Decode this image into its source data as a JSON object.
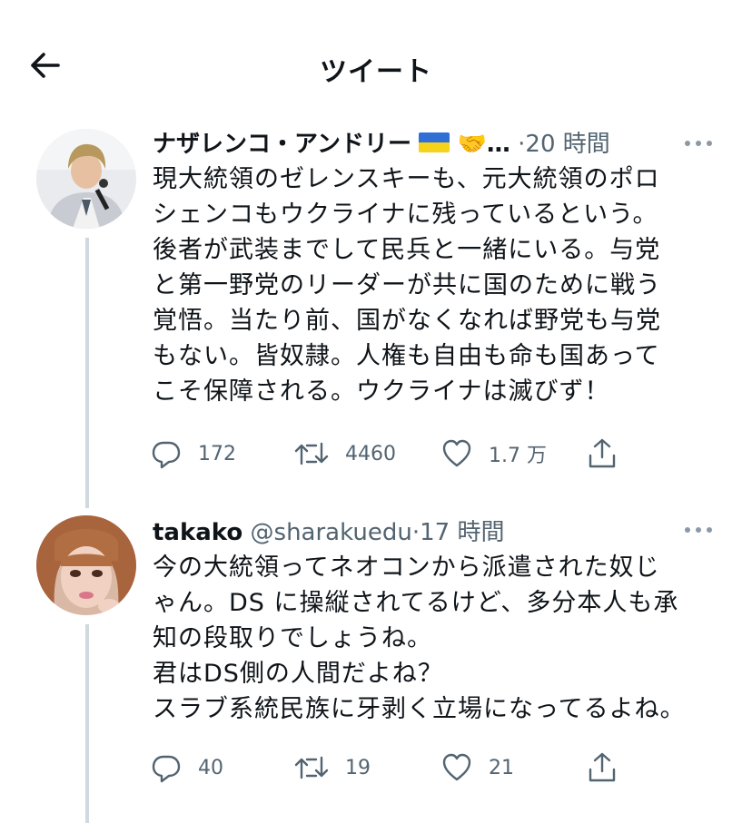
{
  "header": {
    "title": "ツイート"
  },
  "tweets": [
    {
      "name": "ナザレンコ・アンドリー",
      "name_suffix": "…",
      "emoji": "🤝",
      "handle": "",
      "separator": "·",
      "time": "20 時間",
      "text": "現大統領のゼレンスキーも、元大統領のポロ\nシェンコもウクライナに残っているという。\n後者が武装までして民兵と一緒にいる。与党\nと第一野党のリーダーが共に国のために戦う\n覚悟。当たり前、国がなくなれば野党も与党\nもない。皆奴隷。人権も自由も命も国あって\nこそ保障される。ウクライナは滅びず！",
      "replies": "172",
      "retweets": "4460",
      "likes": "1.7 万"
    },
    {
      "name": "takako",
      "name_suffix": "",
      "emoji": "",
      "handle": "@sharakuedu",
      "separator": "·",
      "time": "17 時間",
      "text": "今の大統領ってネオコンから派遣された奴じ\nゃん。DS に操縦されてるけど、多分本人も承\n知の段取りでしょうね。\n君はDS側の人間だよね？\nスラブ系統民族に牙剥く立場になってるよね。",
      "replies": "40",
      "retweets": "19",
      "likes": "21"
    }
  ],
  "colors": {
    "text": "#0f1419",
    "secondary": "#536471",
    "thread_line": "#cfd9de",
    "flag_blue": "#2f6fd6",
    "flag_yellow": "#f7d21b"
  },
  "icons": [
    "back-arrow-icon",
    "more-icon",
    "reply-icon",
    "retweet-icon",
    "like-icon",
    "share-icon",
    "ukraine-flag-icon"
  ]
}
